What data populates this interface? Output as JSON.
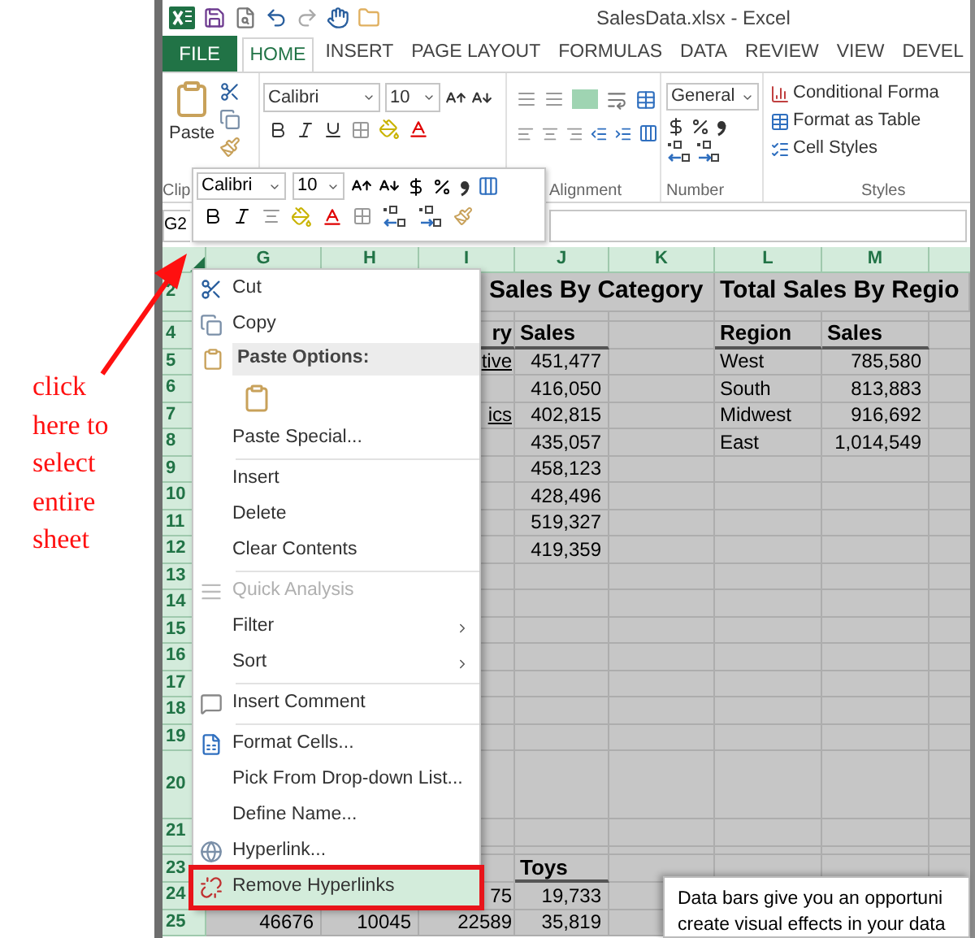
{
  "annotation": {
    "lines": [
      "click",
      "here to",
      "select",
      "entire",
      "sheet"
    ]
  },
  "window": {
    "title": "SalesData.xlsx - Excel"
  },
  "ribbon_tabs": [
    {
      "label": "FILE",
      "kind": "file",
      "selected": false
    },
    {
      "label": "HOME",
      "kind": "tab",
      "selected": true
    },
    {
      "label": "INSERT",
      "kind": "tab",
      "selected": false
    },
    {
      "label": "PAGE LAYOUT",
      "kind": "tab",
      "selected": false
    },
    {
      "label": "FORMULAS",
      "kind": "tab",
      "selected": false
    },
    {
      "label": "DATA",
      "kind": "tab",
      "selected": false
    },
    {
      "label": "REVIEW",
      "kind": "tab",
      "selected": false
    },
    {
      "label": "VIEW",
      "kind": "tab",
      "selected": false
    },
    {
      "label": "DEVEL",
      "kind": "tab",
      "selected": false
    }
  ],
  "ribbon": {
    "paste_label": "Paste",
    "font_name": "Calibri",
    "font_size": "10",
    "number_format": "General",
    "styles": [
      "Conditional Forma",
      "Format as Table",
      "Cell Styles"
    ],
    "group_labels": [
      "Clip",
      "Alignment",
      "Number",
      "Styles"
    ]
  },
  "mini_toolbar": {
    "font_name": "Calibri",
    "font_size": "10"
  },
  "name_box": "G2",
  "columns": [
    "G",
    "H",
    "I",
    "J",
    "K",
    "L",
    "M"
  ],
  "rows": [
    {
      "header": "2",
      "kind": "title",
      "cells": {
        "i": {
          "text": "Sales By Category"
        },
        "l": {
          "text": "Total Sales By Regio"
        }
      }
    },
    {
      "kind": "spacer",
      "cells": {}
    },
    {
      "header": "4",
      "kind": "header",
      "cells": {
        "i": {
          "text": "ry"
        },
        "j": {
          "text": "Sales"
        },
        "l": {
          "text": "Region"
        },
        "m": {
          "text": "Sales"
        }
      }
    },
    {
      "header": "5",
      "kind": "data",
      "cells": {
        "i": {
          "text": "tive",
          "link": true
        },
        "j": {
          "text": "451,477"
        },
        "l": {
          "text": "West"
        },
        "m": {
          "text": "785,580"
        }
      }
    },
    {
      "header": "6",
      "kind": "data",
      "cells": {
        "j": {
          "text": "416,050"
        },
        "l": {
          "text": "South"
        },
        "m": {
          "text": "813,883"
        }
      }
    },
    {
      "header": "7",
      "kind": "data",
      "cells": {
        "i": {
          "text": "ics",
          "link": true
        },
        "j": {
          "text": "402,815"
        },
        "l": {
          "text": "Midwest"
        },
        "m": {
          "text": "916,692"
        }
      }
    },
    {
      "header": "8",
      "kind": "data",
      "cells": {
        "j": {
          "text": "435,057"
        },
        "l": {
          "text": "East"
        },
        "m": {
          "text": "1,014,549"
        }
      }
    },
    {
      "header": "9",
      "kind": "data",
      "cells": {
        "j": {
          "text": "458,123"
        }
      }
    },
    {
      "header": "10",
      "kind": "data",
      "cells": {
        "j": {
          "text": "428,496"
        }
      }
    },
    {
      "header": "11",
      "kind": "data",
      "cells": {
        "j": {
          "text": "519,327"
        }
      }
    },
    {
      "header": "12",
      "kind": "data",
      "cells": {
        "j": {
          "text": "419,359"
        }
      }
    },
    {
      "header": "13",
      "kind": "data",
      "cells": {}
    },
    {
      "header": "14",
      "kind": "data",
      "cells": {}
    },
    {
      "header": "15",
      "kind": "data",
      "cells": {}
    },
    {
      "header": "16",
      "kind": "data",
      "cells": {}
    },
    {
      "header": "17",
      "kind": "data",
      "cells": {}
    },
    {
      "header": "18",
      "kind": "data",
      "cells": {}
    },
    {
      "header": "19",
      "kind": "data",
      "cells": {}
    },
    {
      "header": "20",
      "kind": "tall",
      "cells": {}
    },
    {
      "header": "21",
      "kind": "data",
      "cells": {}
    },
    {
      "kind": "spacer",
      "cells": {}
    },
    {
      "header": "23",
      "kind": "header",
      "cells": {
        "j": {
          "text": "Toys"
        }
      }
    },
    {
      "header": "24",
      "kind": "data",
      "cells": {
        "i": {
          "text": "75"
        },
        "j": {
          "text": "19,733"
        }
      }
    },
    {
      "header": "25",
      "kind": "data",
      "cells": {
        "g": {
          "text": "46676"
        },
        "h": {
          "text": "10045"
        },
        "i": {
          "text": "22589"
        },
        "j": {
          "text": "35,819"
        }
      }
    }
  ],
  "context_menu": [
    {
      "kind": "item",
      "label": "Cut",
      "disabled": false,
      "submenu": false,
      "selected": false
    },
    {
      "kind": "item",
      "label": "Copy",
      "disabled": false,
      "submenu": false,
      "selected": false
    },
    {
      "kind": "header",
      "label": "Paste Options:"
    },
    {
      "kind": "paste_icons"
    },
    {
      "kind": "item",
      "label": "Paste Special...",
      "disabled": false,
      "submenu": false,
      "selected": false
    },
    {
      "kind": "separator"
    },
    {
      "kind": "item",
      "label": "Insert",
      "disabled": false,
      "submenu": false,
      "selected": false
    },
    {
      "kind": "item",
      "label": "Delete",
      "disabled": false,
      "submenu": false,
      "selected": false
    },
    {
      "kind": "item",
      "label": "Clear Contents",
      "disabled": false,
      "submenu": false,
      "selected": false
    },
    {
      "kind": "separator"
    },
    {
      "kind": "item",
      "label": "Quick Analysis",
      "disabled": true,
      "submenu": false,
      "selected": false
    },
    {
      "kind": "item",
      "label": "Filter",
      "disabled": false,
      "submenu": true,
      "selected": false
    },
    {
      "kind": "item",
      "label": "Sort",
      "disabled": false,
      "submenu": true,
      "selected": false
    },
    {
      "kind": "separator"
    },
    {
      "kind": "item",
      "label": "Insert Comment",
      "disabled": false,
      "submenu": false,
      "selected": false
    },
    {
      "kind": "separator"
    },
    {
      "kind": "item",
      "label": "Format Cells...",
      "disabled": false,
      "submenu": false,
      "selected": false
    },
    {
      "kind": "item",
      "label": "Pick From Drop-down List...",
      "disabled": false,
      "submenu": false,
      "selected": false
    },
    {
      "kind": "item",
      "label": "Define Name...",
      "disabled": false,
      "submenu": false,
      "selected": false
    },
    {
      "kind": "item",
      "label": "Hyperlink...",
      "disabled": false,
      "submenu": false,
      "selected": false
    },
    {
      "kind": "item",
      "label": "Remove Hyperlinks",
      "disabled": false,
      "submenu": false,
      "selected": true
    }
  ],
  "text_box": {
    "lines": [
      "Data bars give you an opportuni",
      "create visual effects in your data"
    ]
  }
}
